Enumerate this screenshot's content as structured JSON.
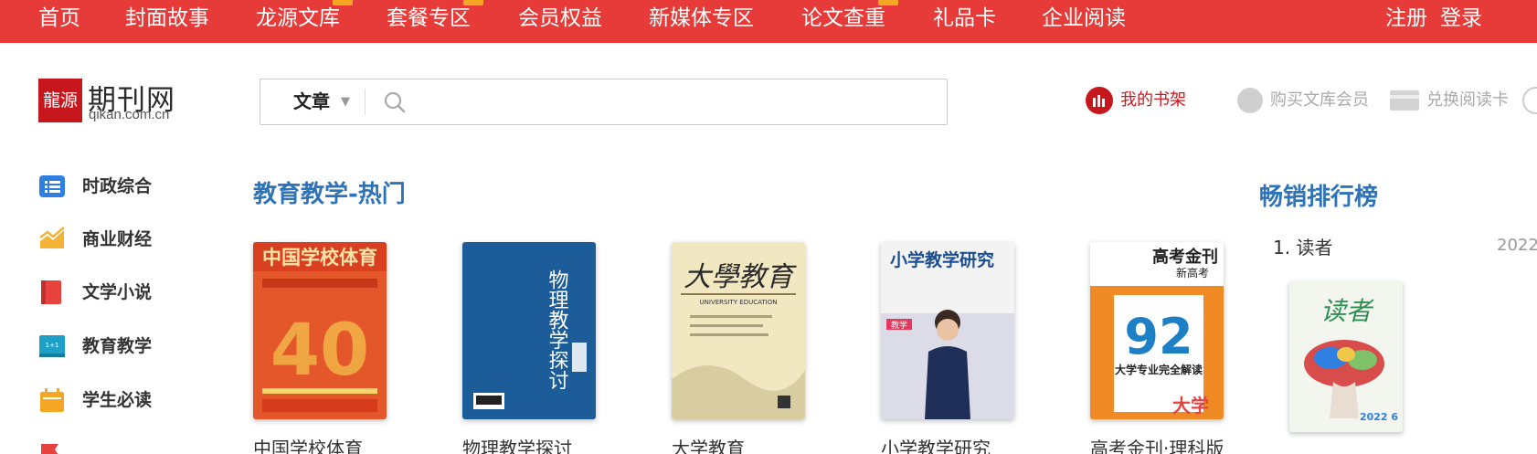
{
  "topnav": {
    "items": [
      "首页",
      "封面故事",
      "龙源文库",
      "套餐专区",
      "会员权益",
      "新媒体专区",
      "论文查重",
      "礼品卡",
      "企业阅读"
    ],
    "register": "注册",
    "login": "登录"
  },
  "header": {
    "logo_name": "期刊网",
    "logo_domain": "qikan.com.cn",
    "search_scope": "文章",
    "search_placeholder": "",
    "my_shelf": "我的书架",
    "buy_member": "购买文库会员",
    "redeem_card": "兑换阅读卡"
  },
  "sidebar": {
    "items": [
      {
        "label": "时政综合",
        "icon": "list-icon",
        "color": "#2f7fe0"
      },
      {
        "label": "商业财经",
        "icon": "trend-chart-icon",
        "color": "#f5b335"
      },
      {
        "label": "文学小说",
        "icon": "book-icon",
        "color": "#e8423f"
      },
      {
        "label": "教育教学",
        "icon": "classroom-icon",
        "color": "#1e9fc6"
      },
      {
        "label": "学生必读",
        "icon": "calendar-icon",
        "color": "#f5a623"
      },
      {
        "label": "",
        "icon": "flag-icon",
        "color": "#e8423f"
      }
    ]
  },
  "main": {
    "section_title": "教育教学-热门",
    "books": [
      {
        "title": "中国学校体育",
        "cover_color": "#e3572a"
      },
      {
        "title": "物理教学探讨",
        "cover_color": "#1c5d99"
      },
      {
        "title": "大学教育",
        "cover_color": "#f1e7c1"
      },
      {
        "title": "小学教学研究",
        "cover_color": "#ececf2"
      },
      {
        "title": "高考金刊·理科版",
        "cover_color": "#f08a25"
      }
    ],
    "book_cover_texts": {
      "b1_top": "中国学校体育",
      "b1_big": "40",
      "b2_text": "物理教学探讨",
      "b3_text": "大學教育",
      "b3_sub": "UNIVERSITY EDUCATION",
      "b4_text": "小学教学研究",
      "b4_tag": "教学",
      "b5_top": "高考金刊",
      "b5_sub": "新高考",
      "b5_big": "92",
      "b5_mid": "大学专业完全解读",
      "b5_bottom": "大学"
    }
  },
  "ranking": {
    "title": "畅销排行榜",
    "first_item": "1. 读者",
    "first_date": "2022",
    "cover_title": "读者",
    "cover_issue": "2022 6"
  }
}
